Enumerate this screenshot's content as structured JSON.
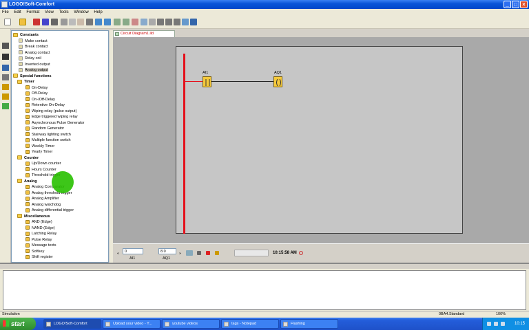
{
  "window": {
    "title": "LOGO!Soft-Comfort"
  },
  "menu": [
    "File",
    "Edit",
    "Format",
    "View",
    "Tools",
    "Window",
    "Help"
  ],
  "tree": {
    "groups": [
      {
        "label": "Constants",
        "items": [
          "Make contact",
          "Break contact",
          "Analog contact",
          "Relay coil",
          "Inverted output",
          "Analog output"
        ]
      },
      {
        "label": "Special functions",
        "items": []
      },
      {
        "label": "Timer",
        "items": [
          "On-Delay",
          "Off-Delay",
          "On-/Off-Delay",
          "Retentive On-Delay",
          "Wiping relay (pulse output)",
          "Edge triggered wiping relay",
          "Asynchronous Pulse Generator",
          "Random Generator",
          "Stairway lighting switch",
          "Multiple function switch",
          "Weekly Timer",
          "Yearly Timer"
        ]
      },
      {
        "label": "Counter",
        "items": [
          "Up/Down counter",
          "Hours Counter",
          "Threshold trigger"
        ]
      },
      {
        "label": "Analog",
        "items": [
          "Analog Comparator",
          "Analog threshold trigger",
          "Analog Amplifier",
          "Analog watchdog",
          "Analog differential trigger"
        ]
      },
      {
        "label": "Miscellaneous",
        "items": [
          "AND (Edge)",
          "NAND (Edge)",
          "Latching Relay",
          "Pulse Relay",
          "Message texts",
          "Softkey",
          "Shift register"
        ]
      }
    ],
    "selected": "Analog output"
  },
  "tab": {
    "label": "Circuit Diagram1.lld"
  },
  "diagram": {
    "block1_label": "AI1",
    "block2_label": "AQ1"
  },
  "simulation": {
    "ai_label": "AI1",
    "ai_value": "0",
    "aq_label": "AQ1",
    "aq_value": "8.0",
    "time": "10:15:58 AM"
  },
  "status": {
    "left": "Simulation",
    "device": "0BA4.Standard",
    "zoom": "100%"
  },
  "taskbar": {
    "start": "start",
    "tasks": [
      "LOGO!Soft-Comfort",
      "Upload your video - Y...",
      "youtube videos",
      "tags - Notepad",
      "Flashing"
    ],
    "clock": "10:15"
  }
}
